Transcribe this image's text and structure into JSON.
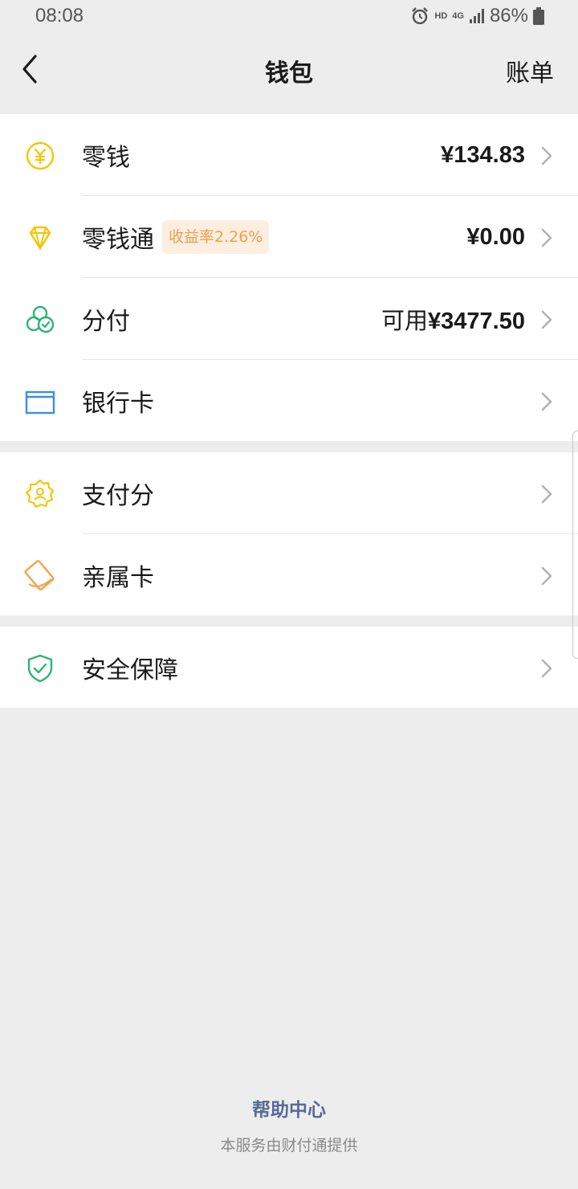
{
  "status_bar": {
    "time": "08:08",
    "hd": "HD",
    "network": "4G",
    "battery": "86%"
  },
  "nav": {
    "title": "钱包",
    "right_label": "账单",
    "back_icon": "chevron-left-icon"
  },
  "groups": [
    {
      "items": [
        {
          "label": "零钱",
          "value": "¥134.83",
          "icon": "yuan-coin-icon",
          "icon_color": "#f5c400"
        },
        {
          "label": "零钱通",
          "badge": "收益率2.26%",
          "value": "¥0.00",
          "icon": "diamond-icon",
          "icon_color": "#f5c400"
        },
        {
          "label": "分付",
          "value_prefix": "可用",
          "value": "¥3477.50",
          "icon": "clover-check-icon",
          "icon_color": "#2bb673"
        },
        {
          "label": "银行卡",
          "value": "",
          "icon": "bank-card-icon",
          "icon_color": "#3b8fe0"
        }
      ]
    },
    {
      "items": [
        {
          "label": "支付分",
          "icon": "badge-person-icon",
          "icon_color": "#f5c400"
        },
        {
          "label": "亲属卡",
          "icon": "family-card-icon",
          "icon_color": "#f0a44a"
        }
      ]
    },
    {
      "items": [
        {
          "label": "安全保障",
          "icon": "shield-check-icon",
          "icon_color": "#2bb673"
        }
      ]
    }
  ],
  "footer": {
    "help_link": "帮助中心",
    "provider_note": "本服务由财付通提供"
  }
}
